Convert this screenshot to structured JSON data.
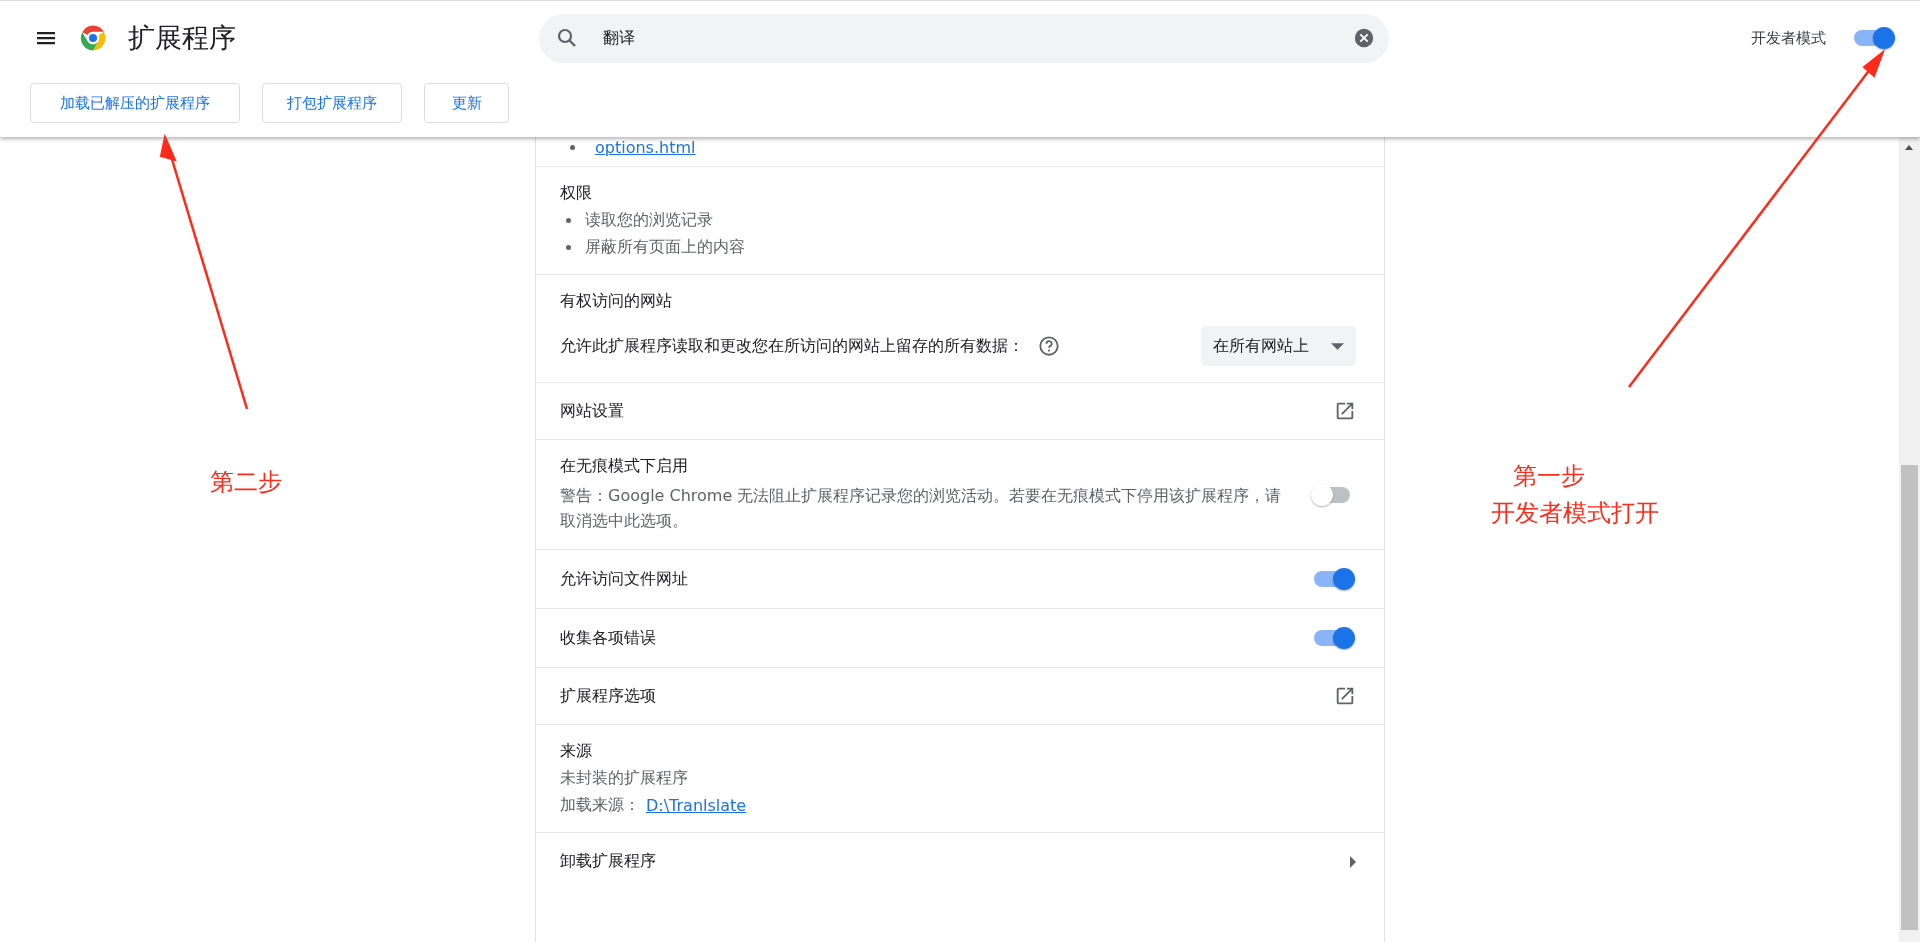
{
  "header": {
    "title": "扩展程序",
    "search": {
      "value": "翻译"
    },
    "developer_mode": {
      "label": "开发者模式",
      "on": true
    }
  },
  "toolbar_buttons": [
    "加载已解压的扩展程序",
    "打包扩展程序",
    "更新"
  ],
  "details": {
    "top_link": "options.html",
    "sections": [
      {
        "kind": "list",
        "title": "权限",
        "items": [
          "读取您的浏览记录",
          "屏蔽所有页面上的内容"
        ]
      },
      {
        "kind": "site_access",
        "title": "有权访问的网站",
        "description": "允许此扩展程序读取和更改您在所访问的网站上留存的所有数据：",
        "select": "在所有网站上"
      },
      {
        "kind": "link",
        "title": "网站设置"
      },
      {
        "kind": "toggle",
        "title": "在无痕模式下启用",
        "description": "警告：Google Chrome 无法阻止扩展程序记录您的浏览活动。若要在无痕模式下停用该扩展程序，请取消选中此选项。",
        "on": false
      },
      {
        "kind": "toggle",
        "title": "允许访问文件网址",
        "on": true
      },
      {
        "kind": "toggle",
        "title": "收集各项错误",
        "on": true
      },
      {
        "kind": "link",
        "title": "扩展程序选项"
      },
      {
        "kind": "source",
        "title": "来源",
        "text": "未封装的扩展程序",
        "load_label": "加载来源：",
        "load_link": "D:\\Tranlslate"
      },
      {
        "kind": "nav",
        "title": "卸载扩展程序"
      }
    ]
  },
  "annotations": [
    "第二步",
    "第一步",
    "开发者模式打开"
  ]
}
